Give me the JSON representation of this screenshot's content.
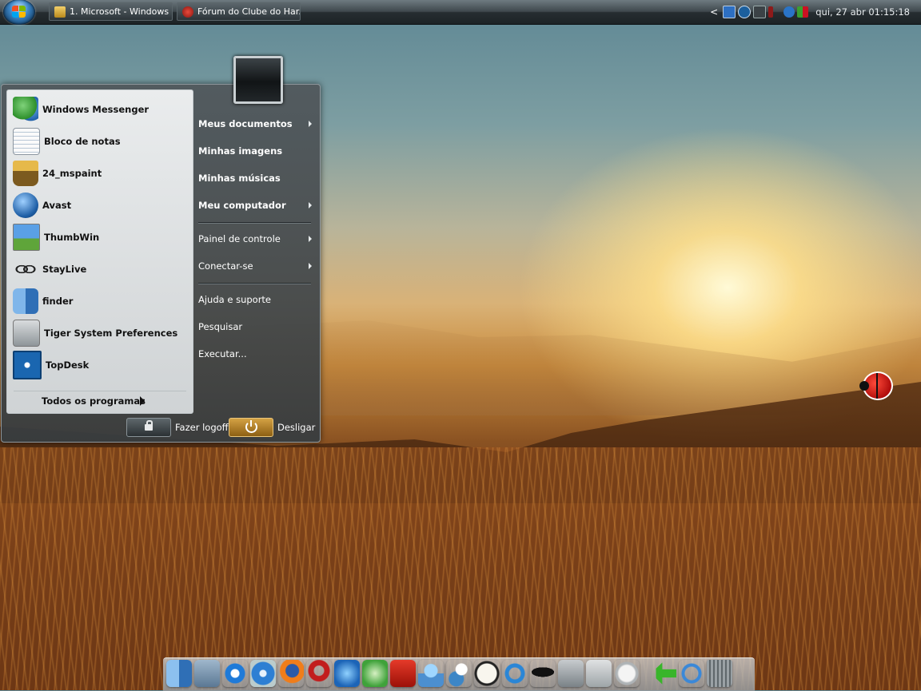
{
  "taskbar": {
    "windows": [
      {
        "label": "1. Microsoft - Windows ...",
        "icon": "window-icon"
      },
      {
        "label": "Fórum do Clube do Har...",
        "icon": "forum-icon"
      }
    ],
    "tray_arrow": "<",
    "clock": "qui, 27 abr 01:15:18"
  },
  "start_menu": {
    "programs": [
      {
        "label": "Windows Messenger",
        "icon": "messenger-icon"
      },
      {
        "label": "Bloco de notas",
        "icon": "notepad-icon"
      },
      {
        "label": "24_mspaint",
        "icon": "paint-icon"
      },
      {
        "label": "Avast",
        "icon": "avast-icon"
      },
      {
        "label": "ThumbWin",
        "icon": "thumbwin-icon"
      },
      {
        "label": "StayLive",
        "icon": "chain-link-icon"
      },
      {
        "label": "finder",
        "icon": "finder-icon"
      },
      {
        "label": "Tiger System Preferences",
        "icon": "system-preferences-icon"
      },
      {
        "label": "TopDesk",
        "icon": "topdesk-icon"
      }
    ],
    "all_programs": "Todos os programas",
    "places": [
      {
        "label": "Meus documentos"
      },
      {
        "label": "Minhas imagens"
      },
      {
        "label": "Minhas músicas"
      },
      {
        "label": "Meu computador"
      }
    ],
    "system": [
      {
        "label": "Painel de controle"
      },
      {
        "label": "Conectar-se"
      }
    ],
    "help": [
      {
        "label": "Ajuda e suporte"
      },
      {
        "label": "Pesquisar"
      },
      {
        "label": "Executar..."
      }
    ],
    "logoff": "Fazer logoff",
    "shutdown": "Desligar"
  },
  "dock": {
    "icons": [
      "finder-icon",
      "folder-icon",
      "internet-explorer-icon",
      "safari-icon",
      "firefox-icon",
      "magnet-icon",
      "media-player-icon",
      "itunes-icon",
      "zonealarm-icon",
      "messenger-icon",
      "chat-icon",
      "clock-icon",
      "network-icon",
      "spy-icon",
      "hard-drive-icon",
      "system-preferences-icon",
      "apple-icon",
      "back-arrow-icon",
      "power-icon",
      "trash-icon"
    ]
  },
  "colors": {
    "accent_power": "#c58f2c",
    "taskbar": "#2c3438"
  }
}
